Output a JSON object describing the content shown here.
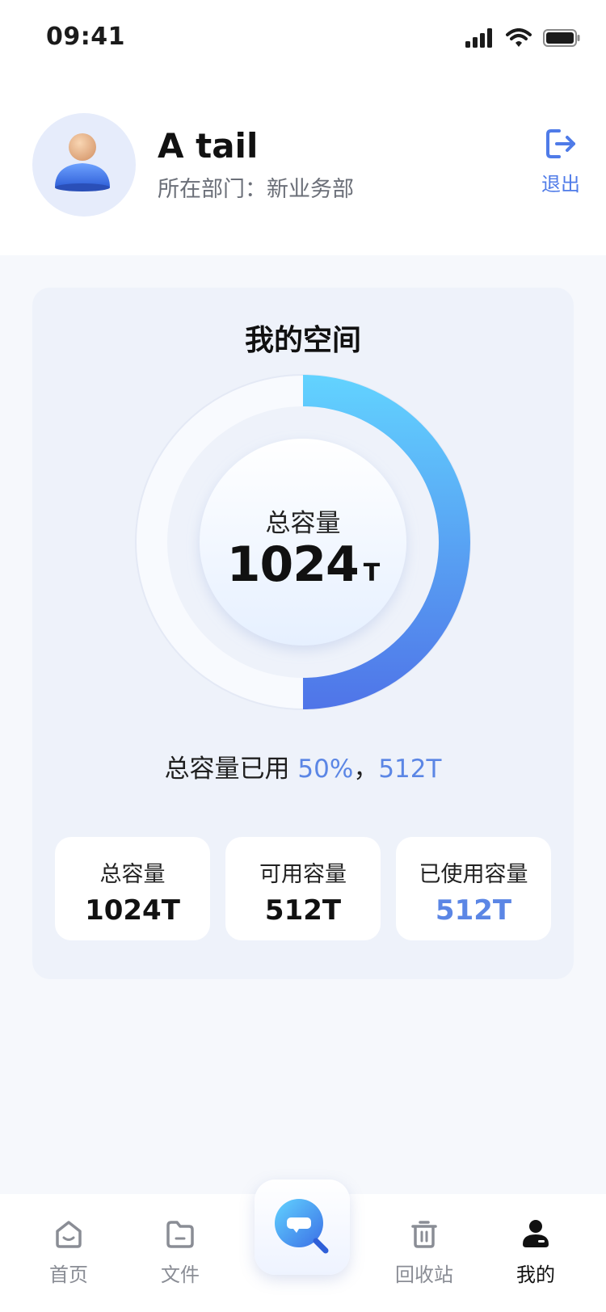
{
  "status_bar": {
    "time": "09:41"
  },
  "profile": {
    "name": "A tail",
    "department_label": "所在部门：新业务部",
    "logout_label": "退出",
    "avatar_icon": "user-avatar-icon",
    "logout_icon": "logout-icon"
  },
  "space_card": {
    "title": "我的空间",
    "ring_label": "总容量",
    "ring_value": "1024",
    "ring_unit": "T",
    "used_fraction": 0.5,
    "usage_prefix": "总容量已用 ",
    "usage_percent": "50%",
    "usage_separator": "，",
    "usage_amount": "512T",
    "stats": [
      {
        "label": "总容量",
        "value": "1024T"
      },
      {
        "label": "可用容量",
        "value": "512T"
      },
      {
        "label": "已使用容量",
        "value": "512T"
      }
    ]
  },
  "tabbar": {
    "items": [
      {
        "label": "首页",
        "icon": "home-icon"
      },
      {
        "label": "文件",
        "icon": "folder-icon"
      },
      {
        "label": "回收站",
        "icon": "trash-icon"
      },
      {
        "label": "我的",
        "icon": "profile-icon"
      }
    ],
    "center_icon": "chat-search-icon"
  },
  "colors": {
    "accent": "#5b86e5",
    "ring_start": "#62d3ff",
    "ring_end": "#4f74e8",
    "background": "#f6f8fc"
  }
}
